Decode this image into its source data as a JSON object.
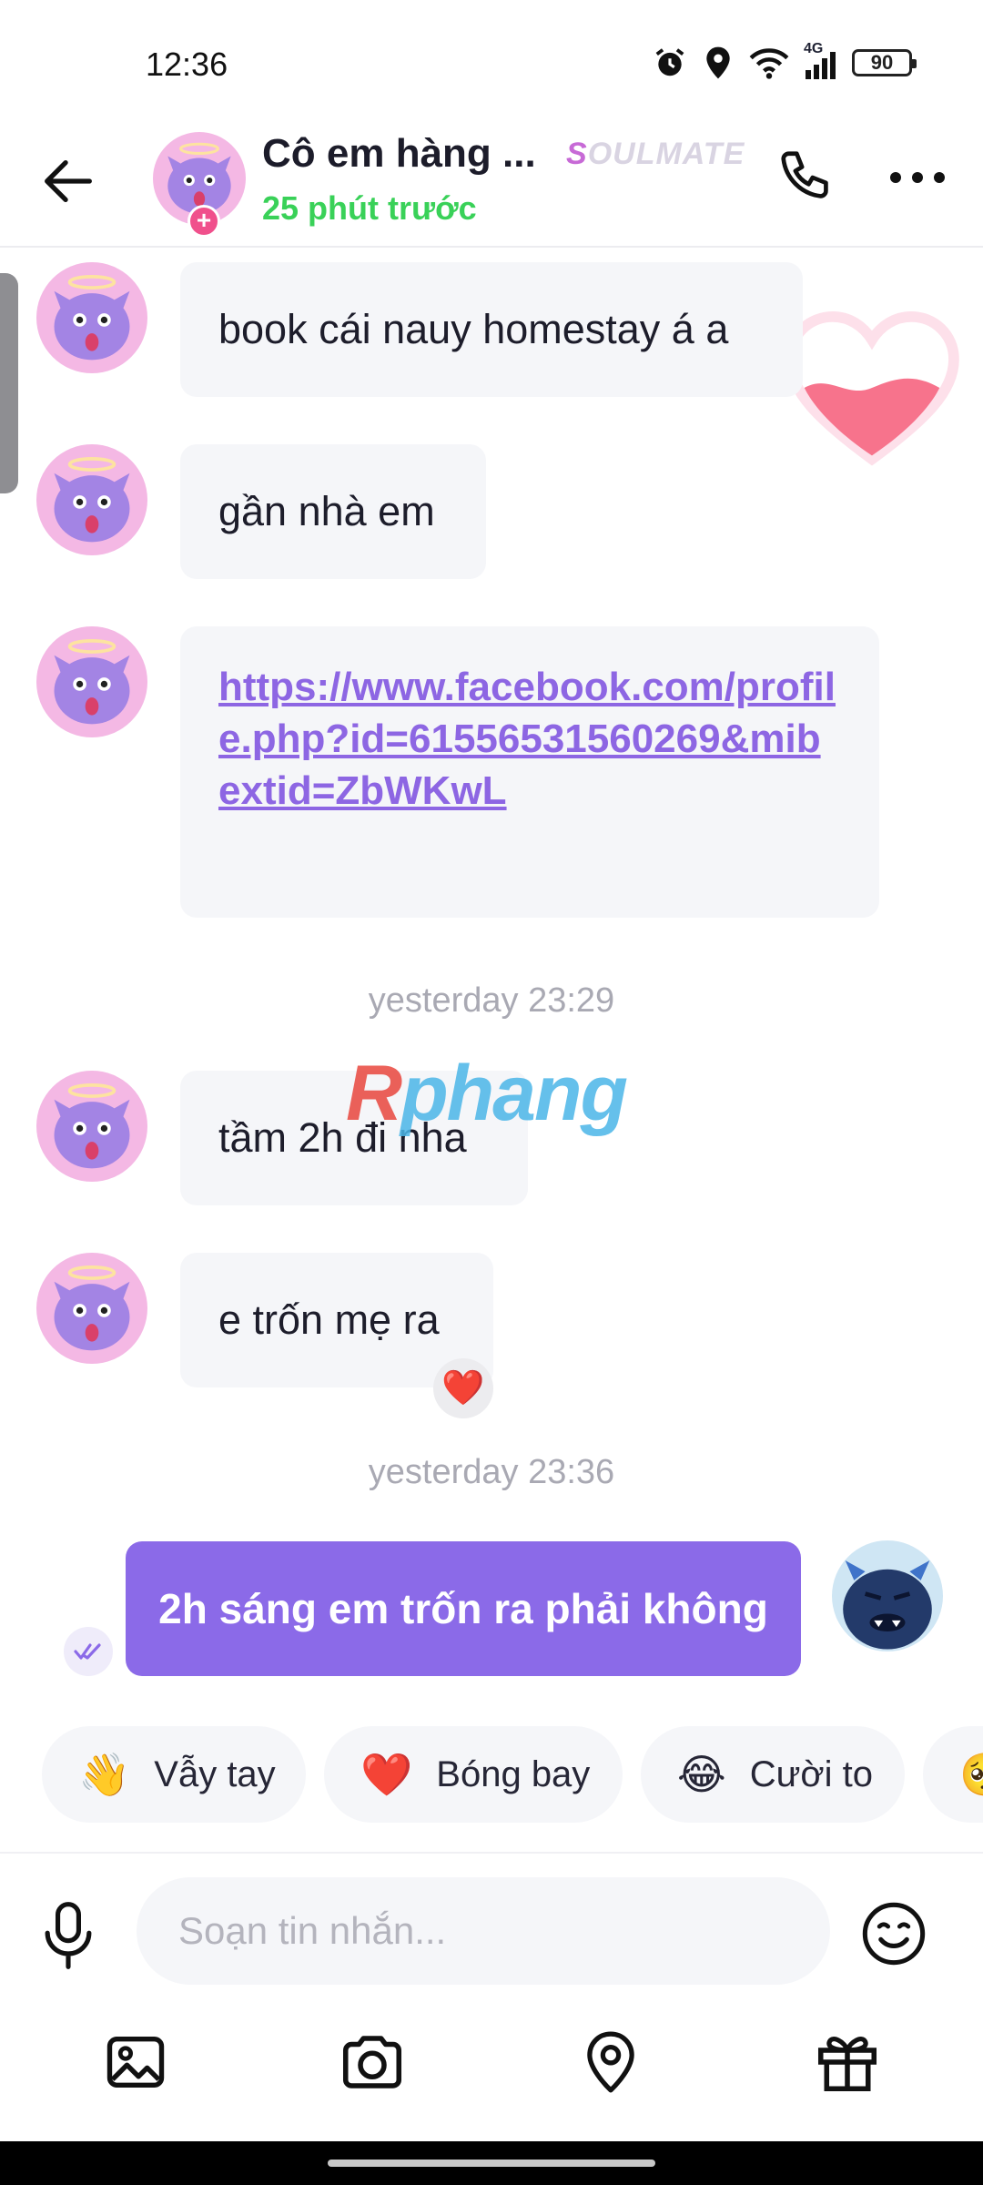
{
  "status_bar": {
    "time": "12:36",
    "network": "4G",
    "battery": "90",
    "icons": [
      "alarm-icon",
      "location-icon",
      "wifi-icon",
      "signal-icon",
      "battery-icon"
    ]
  },
  "header": {
    "contact_name": "Cô em hàng ...",
    "badge": "SOULMATE",
    "last_seen": "25 phút trước",
    "icons": [
      "back-arrow-icon",
      "phone-icon",
      "more-icon"
    ]
  },
  "messages": {
    "m1": "book cái nauy homestay á a",
    "m2": "gần nhà em",
    "m3_link": "https://www.facebook.com/profile.php?id=61556531560269&mibextid=ZbWKwL",
    "time1": "yesterday 23:29",
    "m4": "tầm 2h đi nha",
    "m5": "e trốn mẹ ra",
    "m5_reaction": "❤️",
    "time2": "yesterday 23:36",
    "m6_out": "2h sáng em trốn ra phải không"
  },
  "watermark": {
    "first": "R",
    "rest": "phang"
  },
  "quick_reactions": [
    {
      "emoji": "👋",
      "label": "Vẫy tay"
    },
    {
      "emoji": "❤️",
      "label": "Bóng bay"
    },
    {
      "emoji": "😂",
      "label": "Cười to"
    },
    {
      "emoji": "🥺",
      "label": ""
    }
  ],
  "composer": {
    "placeholder": "Soạn tin nhắn...",
    "value": ""
  },
  "toolbar": {
    "items": [
      "image-icon",
      "camera-icon",
      "location-pin-icon",
      "gift-icon"
    ]
  },
  "colors": {
    "accent": "#8b6ae8",
    "online_green": "#39d158",
    "link": "#8d66e3",
    "avatar_pink": "#f4b8e4"
  }
}
